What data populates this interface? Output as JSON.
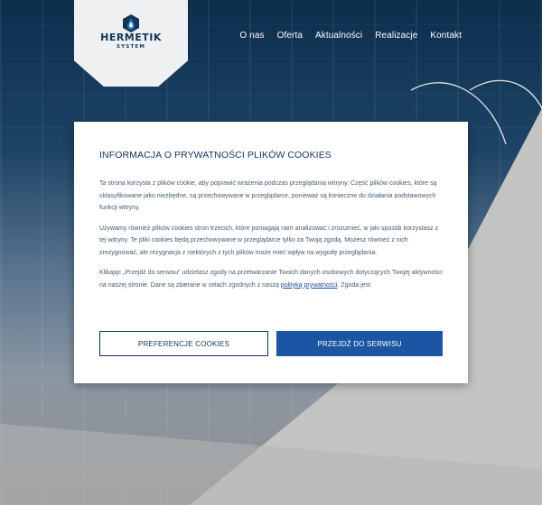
{
  "brand": {
    "name": "HERMETIK",
    "sub": "SYSTEM"
  },
  "nav": {
    "items": [
      {
        "label": "O nas"
      },
      {
        "label": "Oferta"
      },
      {
        "label": "Aktualności"
      },
      {
        "label": "Realizacje"
      },
      {
        "label": "Kontakt"
      }
    ]
  },
  "cookie_dialog": {
    "title": "INFORMACJA O PRYWATNOŚCI PLIKÓW COOKIES",
    "paragraph_1": "Ta strona korzysta z plików cookie, aby poprawić wrażenia podczas przeglądania witryny. Część plików cookies, które są sklasyfikowane jako niezbędne, są przechowywane w przeglądarce, ponieważ są konieczne do działania podstawowych funkcji witryny.",
    "paragraph_2": "Używamy również plików cookies stron trzecich, które pomagają nam analizować i zrozumieć, w jaki sposób korzystasz z tej witryny. Te pliki cookies będą przechowywane w przeglądarce tylko za Twoją zgodą. Możesz również z nich zrezygnować, ale rezygnacja z niektórych z tych plików może mieć wpływ na wygodę przeglądania.",
    "paragraph_3_before": "Klikając „Przejdź do serwisu” udzielasz zgody na przetwarzanie Twoich danych osobowych dotyczących Twojej aktywności na naszej stronie. Dane są zbierane w celach zgodnych z naszą",
    "policy_link": "polityką prywatności",
    "paragraph_3_after": ". Zgoda jest",
    "preferences_button": "PREFERENCJE COOKIES",
    "accept_button": "PRZEJDŹ DO SERWISU"
  },
  "colors": {
    "navy": "#123556",
    "accent_blue": "#1c55a3",
    "logo_blue": "#1f6fb5"
  }
}
